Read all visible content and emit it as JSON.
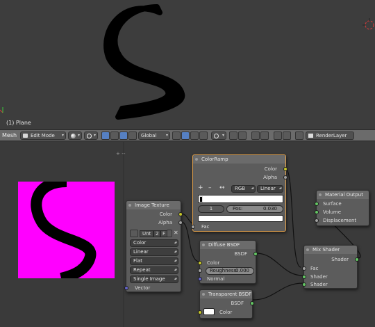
{
  "viewport": {
    "object_label": "(1) Plane"
  },
  "toolbar": {
    "editor_label": "Mesh",
    "mode": "Edit Mode",
    "orientation": "Global",
    "render_layer": "RenderLayer"
  },
  "nodes": {
    "colorramp": {
      "title": "ColorRamp",
      "out_color": "Color",
      "out_alpha": "Alpha",
      "add": "+",
      "remove": "–",
      "flip": "↔",
      "color_mode": "RGB",
      "interpolation": "Linear",
      "index": "1",
      "pos_label": "Pos:",
      "pos_value": "0.030",
      "in_fac": "Fac"
    },
    "image_texture": {
      "title": "Image Texture",
      "out_color": "Color",
      "out_alpha": "Alpha",
      "image_name": "Unt",
      "user_count": "2",
      "fake_user": "F",
      "color_space": "Color",
      "interpolation": "Linear",
      "projection": "Flat",
      "extension": "Repeat",
      "source": "Single Image",
      "in_vector": "Vector"
    },
    "diffuse": {
      "title": "Diffuse BSDF",
      "out_bsdf": "BSDF",
      "in_color": "Color",
      "roughness_label": "Roughness:",
      "roughness_value": "0.000",
      "in_normal": "Normal"
    },
    "transparent": {
      "title": "Transparent BSDF",
      "out_bsdf": "BSDF",
      "in_color": "Color"
    },
    "mix": {
      "title": "Mix Shader",
      "out_shader": "Shader",
      "in_fac": "Fac",
      "in_shader1": "Shader",
      "in_shader2": "Shader"
    },
    "output": {
      "title": "Material Output",
      "in_surface": "Surface",
      "in_volume": "Volume",
      "in_displacement": "Displacement"
    }
  },
  "colors": {
    "preview_bg": "#ff00ff",
    "stroke": "#000000",
    "selected_border": "#e2a04a",
    "socket_color": "#c7c729",
    "socket_shader": "#63c763",
    "socket_float": "#a1a1a1",
    "socket_vector": "#6363c7"
  },
  "icons": [
    "render-layer-icon",
    "viewport-shading-icon",
    "pivot-icon",
    "snap-icon",
    "proportional-edit-icon",
    "magnet-icon"
  ]
}
